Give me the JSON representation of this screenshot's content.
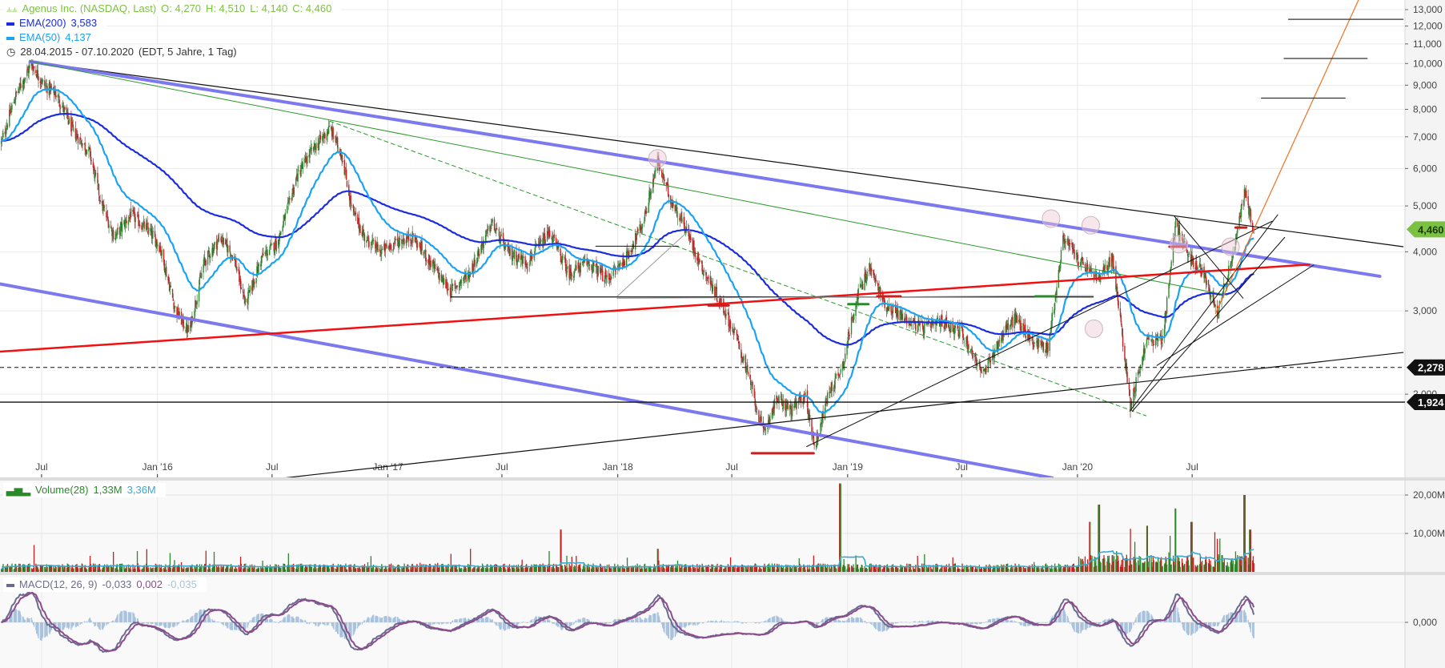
{
  "header": {
    "title": "Agenus Inc. (NASDAQ, Last)",
    "ohlc": {
      "o": "O: 4,270",
      "h": "H: 4,510",
      "l": "L: 4,140",
      "c": "C: 4,460"
    },
    "ema200_label": "EMA(200)",
    "ema200_value": "3,583",
    "ema50_label": "EMA(50)",
    "ema50_value": "4,137",
    "range": "28.04.2015 - 07.10.2020",
    "range_info": "(EDT, 5 Jahre, 1 Tag)"
  },
  "volume_legend": {
    "label": "Volume(28)",
    "value": "1,33M",
    "avg": "3,36M"
  },
  "macd_legend": {
    "label": "MACD(12, 26, 9)",
    "macd": "-0,033",
    "signal": "0,002",
    "hist": "-0,035"
  },
  "colors": {
    "title": "#7cc242",
    "ema200": "#1a2be0",
    "ema50": "#1aa3f5",
    "up": "#2a8a2a",
    "down": "#c81e1e",
    "volume_avg": "#3aa8d0",
    "macd": "#6b6b8f",
    "signal": "#8d4a8d",
    "hist": "#a9c3de",
    "last_price": "#7cc242"
  },
  "chart_data": [
    {
      "type": "candlestick",
      "scale": "log",
      "ylim": [
        1.3,
        13.5
      ],
      "xlim": [
        "2015-04-26",
        "2021-06-04"
      ],
      "grid": true,
      "x_ticks": [
        {
          "date": "2015-07-01",
          "label": "Jul"
        },
        {
          "date": "2016-01-01",
          "label": "Jan '16"
        },
        {
          "date": "2016-07-01",
          "label": "Jul"
        },
        {
          "date": "2017-01-01",
          "label": "Jan '17"
        },
        {
          "date": "2017-07-01",
          "label": "Jul"
        },
        {
          "date": "2018-01-01",
          "label": "Jan '18"
        },
        {
          "date": "2018-07-01",
          "label": "Jul"
        },
        {
          "date": "2019-01-01",
          "label": "Jan '19"
        },
        {
          "date": "2019-07-01",
          "label": "Jul"
        },
        {
          "date": "2020-01-01",
          "label": "Jan '20"
        },
        {
          "date": "2020-07-01",
          "label": "Jul"
        }
      ],
      "y_ticks": [
        {
          "v": 13,
          "label": "13,000"
        },
        {
          "v": 12,
          "label": "12,000"
        },
        {
          "v": 11,
          "label": "11,000"
        },
        {
          "v": 10,
          "label": "10,000"
        },
        {
          "v": 9,
          "label": "9,000"
        },
        {
          "v": 8,
          "label": "8,000"
        },
        {
          "v": 7,
          "label": "7,000"
        },
        {
          "v": 6,
          "label": "6,000"
        },
        {
          "v": 5,
          "label": "5,000"
        },
        {
          "v": 4,
          "label": "4,000"
        },
        {
          "v": 3,
          "label": "3,000"
        },
        {
          "v": 2,
          "label": "2,000"
        }
      ],
      "price_markers": [
        {
          "v": 4.46,
          "label": "4,460",
          "style": "last"
        },
        {
          "v": 2.278,
          "label": "2,278",
          "style": "dashed"
        },
        {
          "v": 1.924,
          "label": "1,924",
          "style": "solid"
        }
      ],
      "close_anchors": [
        [
          "2015-04-28",
          6.8
        ],
        [
          "2015-05-20",
          8.5
        ],
        [
          "2015-06-15",
          10.0
        ],
        [
          "2015-07-05",
          9.0
        ],
        [
          "2015-07-25",
          8.6
        ],
        [
          "2015-08-20",
          7.2
        ],
        [
          "2015-09-15",
          6.5
        ],
        [
          "2015-10-05",
          5.0
        ],
        [
          "2015-10-25",
          4.3
        ],
        [
          "2015-11-20",
          4.8
        ],
        [
          "2015-12-20",
          4.4
        ],
        [
          "2016-01-05",
          4.1
        ],
        [
          "2016-01-30",
          3.0
        ],
        [
          "2016-02-20",
          2.7
        ],
        [
          "2016-03-15",
          3.8
        ],
        [
          "2016-04-10",
          4.3
        ],
        [
          "2016-05-01",
          3.9
        ],
        [
          "2016-05-20",
          3.1
        ],
        [
          "2016-06-15",
          3.9
        ],
        [
          "2016-07-10",
          4.2
        ],
        [
          "2016-08-10",
          5.8
        ],
        [
          "2016-09-01",
          6.5
        ],
        [
          "2016-10-01",
          7.3
        ],
        [
          "2016-10-20",
          6.4
        ],
        [
          "2016-11-05",
          4.9
        ],
        [
          "2016-11-25",
          4.3
        ],
        [
          "2016-12-20",
          4.0
        ],
        [
          "2017-01-15",
          4.2
        ],
        [
          "2017-02-10",
          4.3
        ],
        [
          "2017-03-15",
          3.7
        ],
        [
          "2017-04-10",
          3.3
        ],
        [
          "2017-05-10",
          3.6
        ],
        [
          "2017-06-15",
          4.6
        ],
        [
          "2017-07-10",
          4.0
        ],
        [
          "2017-08-10",
          3.8
        ],
        [
          "2017-09-15",
          4.4
        ],
        [
          "2017-10-15",
          3.6
        ],
        [
          "2017-11-15",
          3.8
        ],
        [
          "2017-12-15",
          3.5
        ],
        [
          "2018-01-15",
          3.9
        ],
        [
          "2018-02-10",
          4.6
        ],
        [
          "2018-03-05",
          6.2
        ],
        [
          "2018-03-25",
          5.2
        ],
        [
          "2018-04-15",
          4.6
        ],
        [
          "2018-05-15",
          3.7
        ],
        [
          "2018-06-15",
          3.1
        ],
        [
          "2018-07-10",
          2.6
        ],
        [
          "2018-07-31",
          2.1
        ],
        [
          "2018-08-20",
          1.65
        ],
        [
          "2018-09-10",
          1.95
        ],
        [
          "2018-10-05",
          1.85
        ],
        [
          "2018-10-25",
          2.0
        ],
        [
          "2018-11-10",
          1.55
        ],
        [
          "2018-12-01",
          2.0
        ],
        [
          "2018-12-24",
          2.3
        ],
        [
          "2019-01-15",
          3.2
        ],
        [
          "2019-02-05",
          3.7
        ],
        [
          "2019-03-01",
          3.1
        ],
        [
          "2019-04-01",
          2.9
        ],
        [
          "2019-05-01",
          2.75
        ],
        [
          "2019-06-01",
          2.85
        ],
        [
          "2019-07-01",
          2.7
        ],
        [
          "2019-08-05",
          2.2
        ],
        [
          "2019-09-05",
          2.7
        ],
        [
          "2019-09-25",
          2.9
        ],
        [
          "2019-10-20",
          2.6
        ],
        [
          "2019-11-15",
          2.5
        ],
        [
          "2019-12-10",
          4.3
        ],
        [
          "2020-01-05",
          3.8
        ],
        [
          "2020-02-05",
          3.5
        ],
        [
          "2020-02-25",
          3.9
        ],
        [
          "2020-03-10",
          2.8
        ],
        [
          "2020-03-25",
          1.9
        ],
        [
          "2020-04-20",
          2.6
        ],
        [
          "2020-05-15",
          2.6
        ],
        [
          "2020-06-05",
          4.6
        ],
        [
          "2020-06-25",
          3.9
        ],
        [
          "2020-07-20",
          3.6
        ],
        [
          "2020-08-10",
          3.0
        ],
        [
          "2020-08-25",
          3.5
        ],
        [
          "2020-09-10",
          4.3
        ],
        [
          "2020-09-22",
          5.4
        ],
        [
          "2020-10-07",
          4.46
        ]
      ],
      "trendlines": [
        {
          "from": [
            "2015-06-13",
            10.1
          ],
          "to": [
            "2021-06-01",
            4.1
          ],
          "color": "#111111",
          "width": 1.2
        },
        {
          "from": [
            "2015-06-13",
            10.1
          ],
          "to": [
            "2021-04-25",
            3.55
          ],
          "color": "#7b78f0",
          "width": 4
        },
        {
          "from": [
            "2015-04-26",
            3.42
          ],
          "to": [
            "2019-11-22",
            1.33
          ],
          "color": "#7b78f0",
          "width": 4
        },
        {
          "from": [
            "2015-06-13",
            10.1
          ],
          "to": [
            "2020-08-25",
            3.24
          ],
          "color": "#2a9a2a",
          "width": 1
        },
        {
          "from": [
            "2016-10-01",
            7.55
          ],
          "to": [
            "2020-04-19",
            1.8
          ],
          "color": "#2a9a2a",
          "width": 1,
          "dash": true
        },
        {
          "from": [
            "2015-04-26",
            2.46
          ],
          "to": [
            "2021-01-03",
            3.76
          ],
          "color": "#f01010",
          "width": 2.5
        },
        {
          "from": [
            "2016-07-20",
            1.33
          ],
          "to": [
            "2021-06-01",
            2.45
          ],
          "color": "#111111",
          "width": 1.2
        },
        {
          "from": [
            "2018-10-28",
            1.55
          ],
          "to": [
            "2020-11-05",
            4.64
          ],
          "color": "#111111",
          "width": 1
        },
        {
          "from": [
            "2017-04-11",
            3.21
          ],
          "to": [
            "2020-01-26",
            3.21
          ],
          "color": "#111111",
          "width": 1.2
        },
        {
          "from": [
            "2017-12-31",
            3.19
          ],
          "to": [
            "2020-01-26",
            3.23
          ],
          "color": "#999999",
          "width": 1
        },
        {
          "from": [
            "2017-11-27",
            4.11
          ],
          "to": [
            "2018-04-07",
            4.11
          ],
          "color": "#111111",
          "width": 1
        },
        {
          "from": [
            "2017-12-31",
            3.22
          ],
          "to": [
            "2018-04-25",
            4.45
          ],
          "color": "#999999",
          "width": 1
        },
        {
          "from": [
            "2020-03-24",
            1.84
          ],
          "to": [
            "2020-11-14",
            4.79
          ],
          "color": "#111111",
          "width": 1
        },
        {
          "from": [
            "2020-03-28",
            1.84
          ],
          "to": [
            "2020-11-25",
            4.29
          ],
          "color": "#111111",
          "width": 1
        },
        {
          "from": [
            "2020-05-06",
            2.3
          ],
          "to": [
            "2021-01-10",
            3.75
          ],
          "color": "#111111",
          "width": 1
        },
        {
          "from": [
            "2020-06-03",
            4.75
          ],
          "to": [
            "2020-09-20",
            3.19
          ],
          "color": "#111111",
          "width": 1
        },
        {
          "from": [
            "2020-08-07",
            2.96
          ],
          "to": [
            "2021-03-22",
            13.6
          ],
          "color": "#f07020",
          "width": 1.2
        },
        {
          "from": [
            "2020-12-01",
            12.4
          ],
          "to": [
            "2021-06-01",
            12.4
          ],
          "color": "#333333",
          "width": 1.2
        },
        {
          "from": [
            "2020-11-24",
            10.25
          ],
          "to": [
            "2021-04-05",
            10.25
          ],
          "color": "#333333",
          "width": 1.2
        },
        {
          "from": [
            "2020-10-19",
            8.45
          ],
          "to": [
            "2021-03-01",
            8.45
          ],
          "color": "#333333",
          "width": 1.2
        },
        {
          "from": [
            "2018-08-02",
            1.5
          ],
          "to": [
            "2018-11-08",
            1.5
          ],
          "color": "#c81e1e",
          "width": 3
        },
        {
          "from": [
            "2018-05-25",
            3.08
          ],
          "to": [
            "2018-06-26",
            3.08
          ],
          "color": "#c81e1e",
          "width": 3
        },
        {
          "from": [
            "2019-01-02",
            3.1
          ],
          "to": [
            "2019-02-03",
            3.1
          ],
          "color": "#2a8a2a",
          "width": 3
        },
        {
          "from": [
            "2019-02-17",
            3.22
          ],
          "to": [
            "2019-03-26",
            3.22
          ],
          "color": "#c81e1e",
          "width": 3
        },
        {
          "from": [
            "2019-10-26",
            3.22
          ],
          "to": [
            "2019-11-25",
            3.22
          ],
          "color": "#2a8a2a",
          "width": 3
        },
        {
          "from": [
            "2020-05-26",
            4.1
          ],
          "to": [
            "2020-06-20",
            4.1
          ],
          "color": "#c81e1e",
          "width": 3
        },
        {
          "from": [
            "2020-09-08",
            4.5
          ],
          "to": [
            "2020-09-25",
            4.5
          ],
          "color": "#c81e1e",
          "width": 3
        }
      ],
      "circles": [
        {
          "date": "2018-03-05",
          "v": 6.3
        },
        {
          "date": "2019-11-20",
          "v": 4.7
        },
        {
          "date": "2020-01-22",
          "v": 4.55
        },
        {
          "date": "2020-01-27",
          "v": 2.75
        },
        {
          "date": "2020-06-10",
          "v": 4.15
        },
        {
          "date": "2020-08-31",
          "v": 4.1
        }
      ]
    },
    {
      "type": "bar",
      "name": "Volume(28)",
      "ylim": [
        0,
        24
      ],
      "unit": "M",
      "y_ticks": [
        {
          "v": 20,
          "label": "20,00M"
        },
        {
          "v": 10,
          "label": "10,00M"
        }
      ],
      "spikes": [
        [
          "2015-06-20",
          7
        ],
        [
          "2017-10-02",
          11
        ],
        [
          "2018-03-05",
          6
        ],
        [
          "2018-12-20",
          23
        ],
        [
          "2020-01-20",
          13
        ],
        [
          "2020-02-04",
          17.5
        ],
        [
          "2020-04-20",
          12
        ],
        [
          "2020-06-05",
          16.5
        ],
        [
          "2020-06-30",
          13
        ],
        [
          "2020-09-22",
          20
        ],
        [
          "2020-10-01",
          11
        ]
      ]
    },
    {
      "type": "line",
      "name": "MACD(12, 26, 9)",
      "y_ticks": [
        {
          "v": 0,
          "label": "0,000"
        }
      ]
    }
  ]
}
